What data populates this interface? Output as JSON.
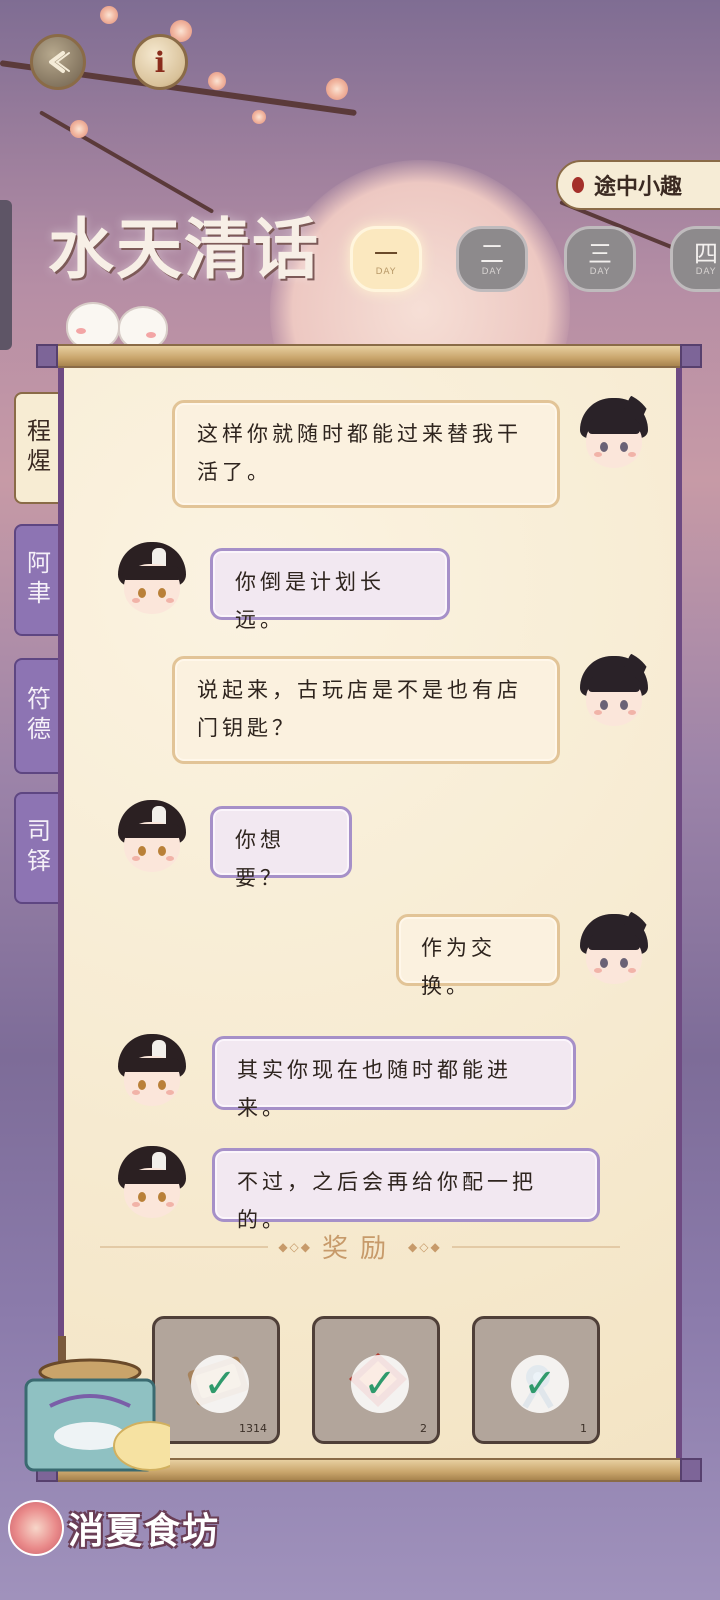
{
  "header": {
    "back_icon": "back-arrow-icon",
    "info_label": "i",
    "tuzhong_label": "途中小趣",
    "title": "水天清话"
  },
  "days": [
    {
      "num": "一",
      "label": "DAY",
      "active": true
    },
    {
      "num": "二",
      "label": "DAY",
      "active": false
    },
    {
      "num": "三",
      "label": "DAY",
      "active": false
    },
    {
      "num": "四",
      "label": "DAY",
      "active": false
    }
  ],
  "side_tabs": [
    {
      "label": "程煋",
      "active": true
    },
    {
      "label": "阿聿",
      "active": false
    },
    {
      "label": "符德",
      "active": false
    },
    {
      "label": "司铎",
      "active": false
    }
  ],
  "messages": [
    {
      "side": "right",
      "text": "这样你就随时都能过来替我干活了。"
    },
    {
      "side": "left",
      "text": "你倒是计划长远。"
    },
    {
      "side": "right",
      "text": "说起来，古玩店是不是也有店门钥匙？"
    },
    {
      "side": "left",
      "text": "你想要？"
    },
    {
      "side": "right",
      "text": "作为交换。"
    },
    {
      "side": "left",
      "text": "其实你现在也随时都能进来。"
    },
    {
      "side": "left",
      "text": "不过，之后会再给你配一把的。"
    }
  ],
  "rewards": {
    "title": "奖励",
    "items": [
      {
        "icon": "ticket-icon",
        "count": "1314",
        "claimed": true
      },
      {
        "icon": "red-gem-icon",
        "count": "2",
        "claimed": true
      },
      {
        "icon": "blue-knot-icon",
        "count": "1",
        "claimed": true
      }
    ]
  },
  "kitchen": {
    "label": "消夏食坊"
  },
  "colors": {
    "accent": "#8d74b3",
    "paper": "#f7ecd3",
    "check": "#2f9a6c"
  }
}
